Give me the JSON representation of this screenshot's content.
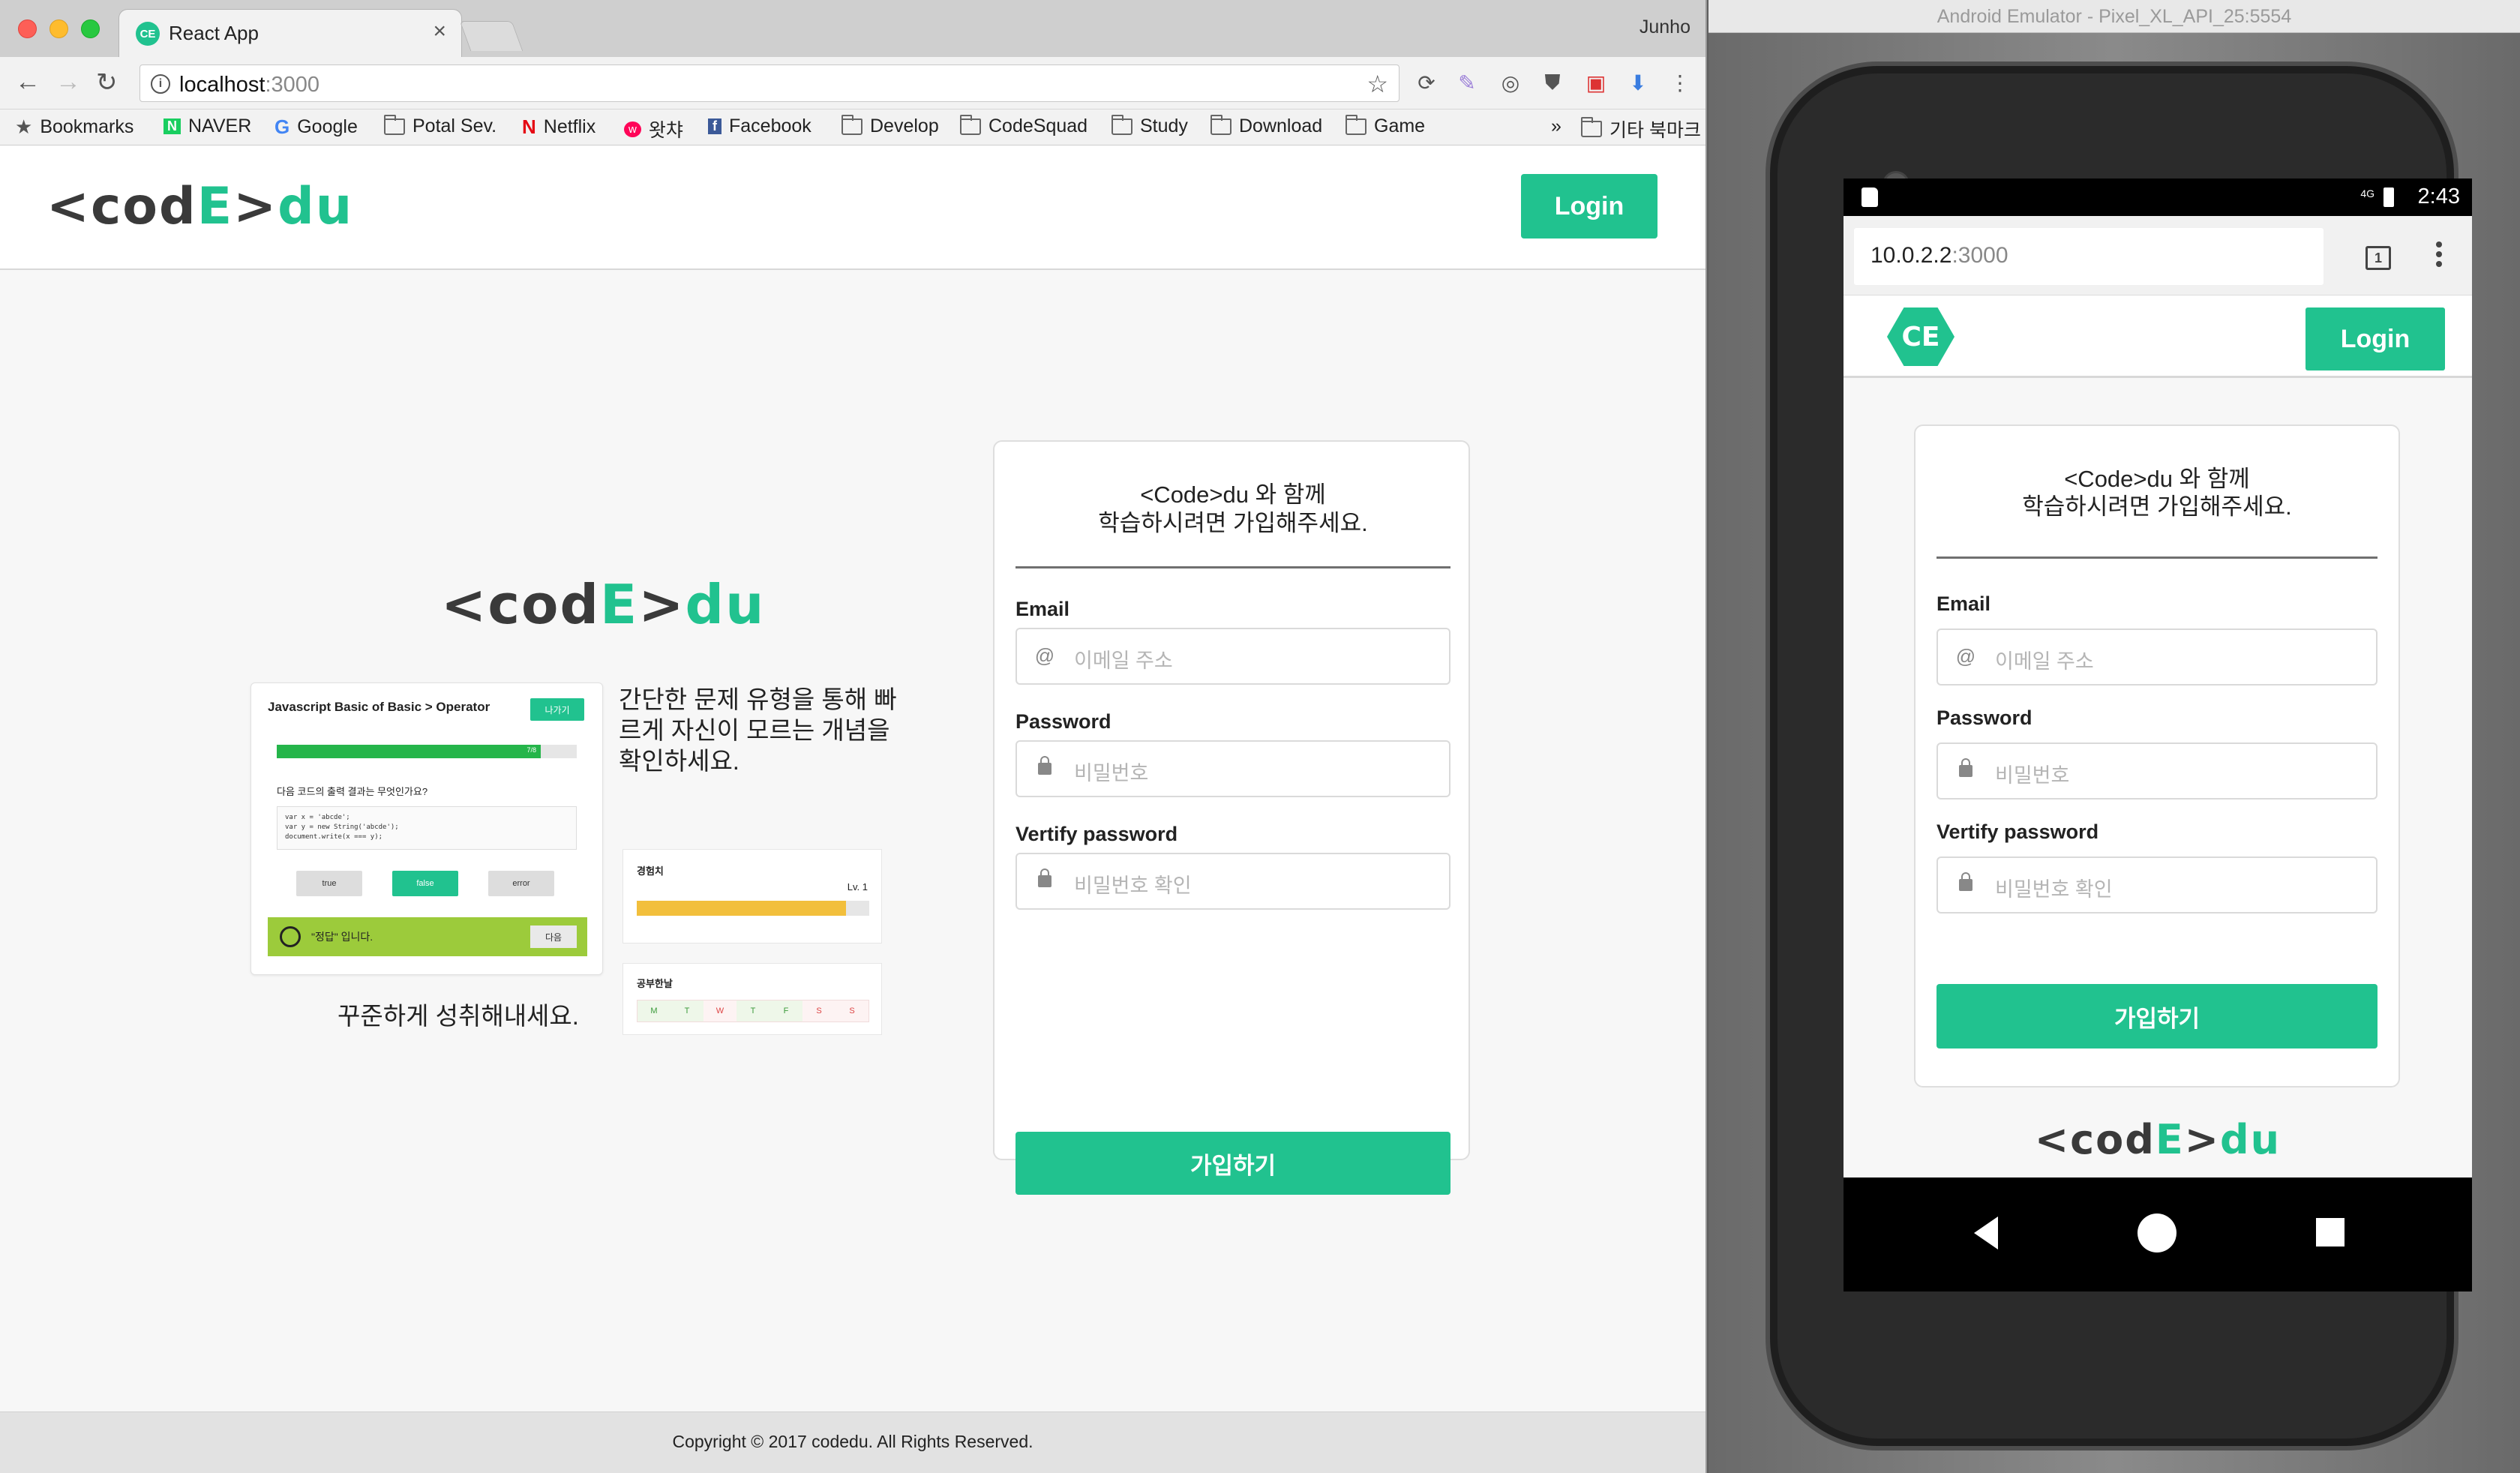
{
  "chrome": {
    "tab_title": "React App",
    "tab_favicon": "CE",
    "profile_name": "Junho",
    "url_host": "localhost",
    "url_port": ":3000",
    "bookmarks": [
      {
        "label": "Bookmarks",
        "icon": "star-icon"
      },
      {
        "label": "NAVER",
        "icon": "naver-icon"
      },
      {
        "label": "Google",
        "icon": "google-icon"
      },
      {
        "label": "Potal Sev.",
        "icon": "folder-icon"
      },
      {
        "label": "Netflix",
        "icon": "netflix-icon"
      },
      {
        "label": "왓챠",
        "icon": "watcha-icon"
      },
      {
        "label": "Facebook",
        "icon": "facebook-icon"
      },
      {
        "label": "Develop",
        "icon": "folder-icon"
      },
      {
        "label": "CodeSquad",
        "icon": "folder-icon"
      },
      {
        "label": "Study",
        "icon": "folder-icon"
      },
      {
        "label": "Download",
        "icon": "folder-icon"
      },
      {
        "label": "Game",
        "icon": "folder-icon"
      }
    ],
    "bookmarks_more": "»",
    "other_bookmarks": "기타 북마크"
  },
  "site": {
    "logo_left": "<cod",
    "logo_e": "E",
    "logo_right": ">",
    "logo_du": "du",
    "login_label": "Login",
    "hero_text_1": "간단한 문제 유형을 통해 빠르게 자신이 모르는 개념을 확인하세요.",
    "hero_text_2": "꾸준하게 성취해내세요.",
    "quiz": {
      "title": "Javascript Basic of Basic > Operator",
      "next": "나가기",
      "progress_label": "7/8",
      "progress": 0.88,
      "question": "다음 코드의 출력 결과는 무엇인가요?",
      "code": "var x = 'abcde';\nvar y = new String('abcde');\ndocument.write(x === y);",
      "options": [
        "true",
        "false",
        "error"
      ],
      "selected": "false",
      "answer_text": "\"정답\" 입니다.",
      "answer_button": "다음"
    },
    "exp": {
      "title": "경험치",
      "level": "Lv. 1",
      "progress": 0.9
    },
    "days": {
      "title": "공부한날",
      "labels": [
        "M",
        "T",
        "W",
        "T",
        "F",
        "S",
        "S"
      ]
    },
    "signup": {
      "heading_line1": "<Code>du 와 함께",
      "heading_line2": "학습하시려면 가입해주세요.",
      "email_label": "Email",
      "email_placeholder": "이메일 주소",
      "password_label": "Password",
      "password_placeholder": "비밀번호",
      "verify_label": "Vertify password",
      "verify_placeholder": "비밀번호 확인",
      "submit": "가입하기"
    },
    "footer": "Copyright © 2017 codedu. All Rights Reserved."
  },
  "emulator": {
    "window_title": "Android Emulator - Pixel_XL_API_25:5554",
    "time": "2:43",
    "network": "4G",
    "url_host": "10.0.2.2",
    "url_port": ":3000",
    "tab_count": "1",
    "badge": "CE"
  },
  "colors": {
    "accent": "#21c28f",
    "dark": "#3a3a3a",
    "answer_green": "#9ccb3b",
    "exp_yellow": "#f2bf3c"
  }
}
